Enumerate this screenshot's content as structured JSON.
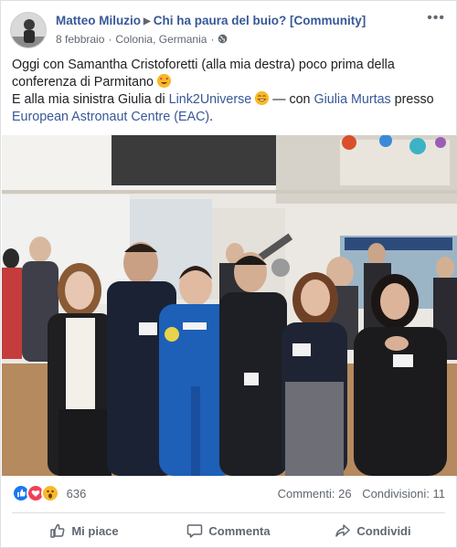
{
  "post": {
    "author": "Matteo Miluzio",
    "group": "Chi ha paura del buio? [Community]",
    "date": "8 febbraio",
    "location": "Colonia, Germania",
    "more_icon": "more-icon",
    "text": {
      "line1": "Oggi con Samantha Cristoforetti (alla mia destra) poco prima della conferenza di Parmitano",
      "line2_prefix": "E alla mia sinistra Giulia di ",
      "link_link2universe": "Link2Universe",
      "with_prefix": " — con ",
      "tag_person": "Giulia Murtas",
      "presso": " presso",
      "tag_place": "European Astronaut Centre (EAC)",
      "end": "."
    }
  },
  "reactions": {
    "count": "636",
    "icons": [
      "like-icon",
      "love-icon",
      "wow-icon"
    ],
    "colors": {
      "like": "#1877f2",
      "love": "#f33e58",
      "wow": "#f7b928"
    }
  },
  "stats": {
    "comments": "Commenti: 26",
    "shares": "Condivisioni: 11"
  },
  "actions": {
    "like": "Mi piace",
    "comment": "Commenta",
    "share": "Condividi"
  }
}
